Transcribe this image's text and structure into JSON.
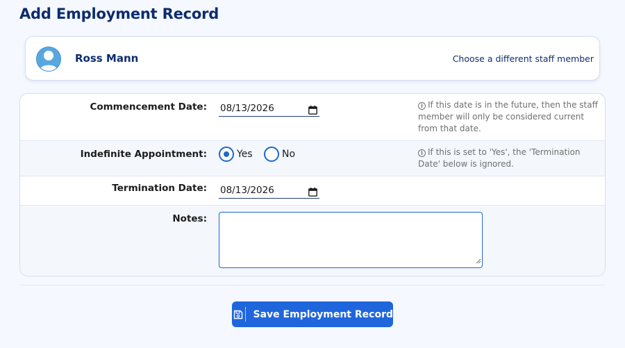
{
  "page": {
    "title": "Add Employment Record"
  },
  "staff": {
    "name": "Ross Mann",
    "change_link": "Choose a different staff member",
    "avatar_icon": "user-avatar-icon"
  },
  "form": {
    "commencement": {
      "label": "Commencement Date:",
      "value": "08/13/2026",
      "help": "If this date is in the future, then the staff member will only be considered current from that date."
    },
    "indefinite": {
      "label": "Indefinite Appointment:",
      "options": [
        "Yes",
        "No"
      ],
      "selected": "Yes",
      "help": "If this is set to 'Yes', the 'Termination Date' below is ignored."
    },
    "termination": {
      "label": "Termination Date:",
      "value": "08/13/2026"
    },
    "notes": {
      "label": "Notes:",
      "value": ""
    }
  },
  "actions": {
    "save_label": "Save Employment Record",
    "save_icon": "save-icon"
  },
  "colors": {
    "title": "#0d2c6e",
    "accent": "#1f66dd",
    "page_bg": "#f5f8fe"
  }
}
